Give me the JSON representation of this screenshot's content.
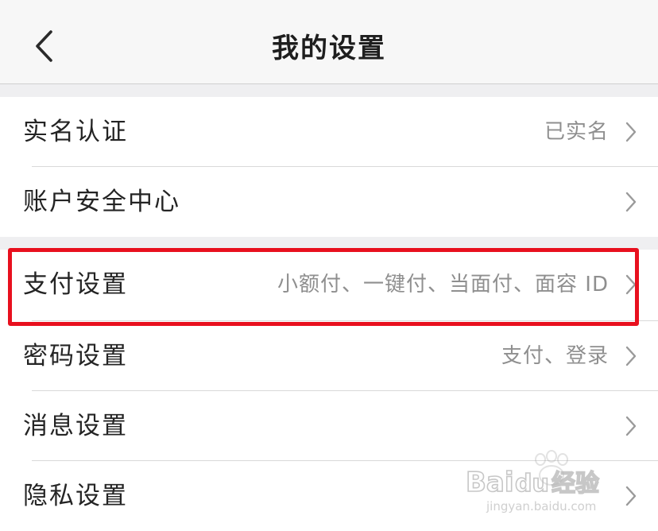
{
  "header": {
    "title": "我的设置",
    "back_icon": "chevron-left-icon"
  },
  "rows": [
    {
      "label": "实名认证",
      "value": "已实名"
    },
    {
      "label": "账户安全中心",
      "value": ""
    },
    {
      "label": "支付设置",
      "value": "小额付、一键付、当面付、面容 ID"
    },
    {
      "label": "密码设置",
      "value": "支付、登录"
    },
    {
      "label": "消息设置",
      "value": ""
    },
    {
      "label": "隐私设置",
      "value": ""
    }
  ],
  "highlight": {
    "color": "#e8101e",
    "target": "支付设置"
  },
  "watermark": {
    "brand": "Baidu经验",
    "url": "jingyan.baidu.com"
  },
  "colors": {
    "nav_bg": "#f7f7f7",
    "section_gap": "#efeff1",
    "value_text": "#8f8f8f"
  }
}
